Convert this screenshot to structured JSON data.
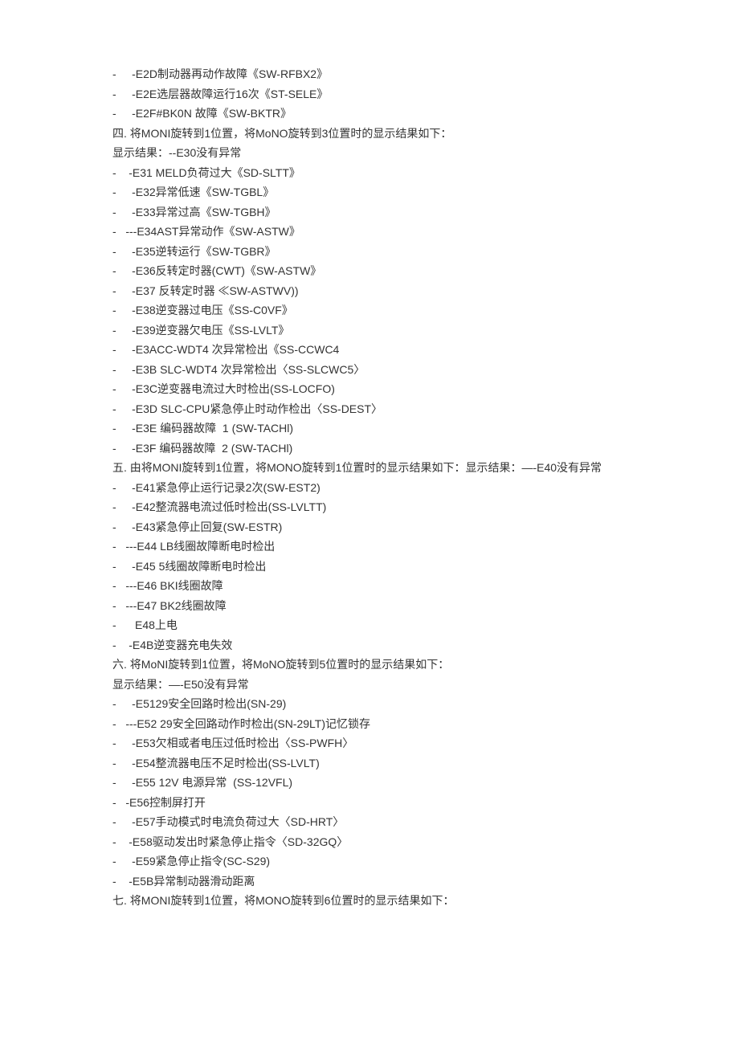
{
  "lines": [
    "-     -E2D制动器再动作故障《SW-RFBX2》",
    "-     -E2E选层器故障运行16次《ST-SELE》",
    "-     -E2F#BK0N 故障《SW-BKTR》",
    "四. 将MONI旋转到1位置，将MoNO旋转到3位置时的显示结果如下：",
    "显示结果：--E30没有异常",
    "-    -E31 MELD负荷过大《SD-SLTT》",
    "-     -E32异常低速《SW-TGBL》",
    "-     -E33异常过高《SW-TGBH》",
    "-   ---E34AST异常动作《SW-ASTW》",
    "-     -E35逆转运行《SW-TGBR》",
    "-     -E36反转定时器(CWT)《SW-ASTW》",
    "-     -E37 反转定时器 ≪SW-ASTWV))",
    "-     -E38逆变器过电压《SS-C0VF》",
    "-     -E39逆变器欠电压《SS-LVLT》",
    "-     -E3ACC-WDT4 次异常检出《SS-CCWC4",
    "-     -E3B SLC-WDT4 次异常检出〈SS-SLCWC5〉",
    "-     -E3C逆变器电流过大时检出(SS-LOCFO)",
    "-     -E3D SLC-CPU紧急停止时动作检出〈SS-DEST〉",
    "-     -E3E 编码器故障  1 (SW-TACHl)",
    "-     -E3F 编码器故障  2 (SW-TACHl)",
    "五. 由将MONI旋转到1位置，将MONO旋转到1位置时的显示结果如下：显示结果：—-E40没有异常",
    "-     -E41紧急停止运行记录2次(SW-EST2)",
    "-     -E42整流器电流过低时检出(SS-LVLTT)",
    "-     -E43紧急停止回复(SW-ESTR)",
    "-   ---E44 LB线圈故障断电时检出",
    "-     -E45 5线圈故障断电时检出",
    "-   ---E46 BKI线圈故障",
    "-   ---E47 BK2线圈故障",
    "-      E48上电",
    "-    -E4B逆变器充电失效",
    "六. 将MoNI旋转到1位置，将MoNO旋转到5位置时的显示结果如下：",
    "显示结果：—-E50没有异常",
    "-     -E5129安全回路时检出(SN-29)",
    "-   ---E52 29安全回路动作时检出(SN-29LT)记忆锁存",
    "-     -E53欠相或者电压过低时检出〈SS-PWFH〉",
    "-     -E54整流器电压不足时检出(SS-LVLT)",
    "-     -E55 12V 电源异常  (SS-12VFL)",
    "-   -E56控制屏打开",
    "-     -E57手动模式时电流负荷过大〈SD-HRT〉",
    "-    -E58驱动发出时紧急停止指令〈SD-32GQ〉",
    "-     -E59紧急停止指令(SC-S29)",
    "-    -E5B异常制动器滑动距离",
    "七. 将MONI旋转到1位置，将MONO旋转到6位置时的显示结果如下："
  ]
}
